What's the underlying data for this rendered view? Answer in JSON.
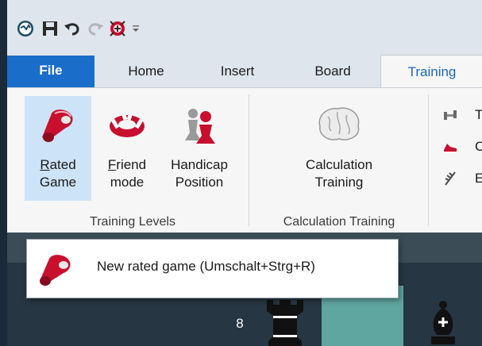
{
  "quick_access": {
    "icons": [
      "app-logo-icon",
      "save-icon",
      "undo-icon",
      "redo-icon",
      "engine-icon",
      "customize-arrow-icon"
    ]
  },
  "tabs": [
    {
      "label": "File"
    },
    {
      "label": "Home"
    },
    {
      "label": "Insert"
    },
    {
      "label": "Board"
    },
    {
      "label": "Training"
    }
  ],
  "ribbon": {
    "training_levels": {
      "buttons": [
        {
          "line1": "Rated",
          "line2": "Game",
          "accel1": "R",
          "rest1": "ated"
        },
        {
          "line1": "Friend",
          "line2": "mode",
          "accel1": "F",
          "rest1": "riend"
        },
        {
          "line1": "Handicap",
          "line2": "Position"
        }
      ],
      "group_label": "Training Levels"
    },
    "calculation": {
      "button": {
        "line1": "Calculation",
        "line2": "Training"
      },
      "group_label": "Calculation Training"
    },
    "small_items": [
      {
        "label": "T"
      },
      {
        "label": "C"
      },
      {
        "label": "E"
      }
    ]
  },
  "tooltip": {
    "text": "New rated game (Umschalt+Strg+R)"
  },
  "board": {
    "rank_label": "8"
  },
  "colors": {
    "file_tab": "#1a6ec9",
    "active_tab_text": "#1d66b9",
    "selected_button": "#cde3f7",
    "board_light": "#5fa5a0",
    "board_dark": "#263642"
  }
}
